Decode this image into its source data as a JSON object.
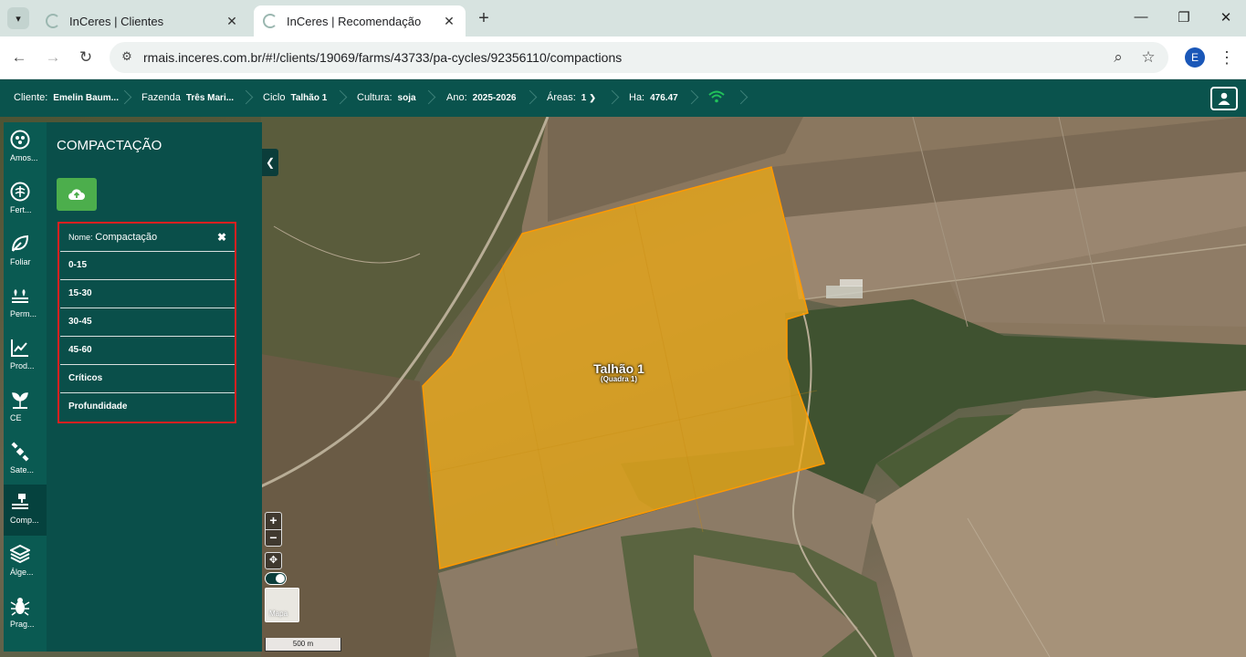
{
  "browser": {
    "tabs": [
      {
        "title": "InCeres | Clientes",
        "active": false
      },
      {
        "title": "InCeres | Recomendação",
        "active": true
      }
    ],
    "url": "rmais.inceres.com.br/#!/clients/19069/farms/43733/pa-cycles/92356110/compactions",
    "profile_initial": "E"
  },
  "header": {
    "crumbs": [
      {
        "key": "Cliente:",
        "value": "Emelin Baum..."
      },
      {
        "key": "Fazenda",
        "value": "Três Mari..."
      },
      {
        "key": "Ciclo",
        "value": "Talhão 1"
      },
      {
        "key": "Cultura:",
        "value": "soja"
      },
      {
        "key": "Ano:",
        "value": "2025-2026"
      },
      {
        "key": "Áreas:",
        "value": "1"
      },
      {
        "key": "Ha:",
        "value": "476.47"
      }
    ],
    "accent": "#21c15a"
  },
  "sidebar": {
    "items": [
      {
        "label": "Amos...",
        "icon": "sampling-icon"
      },
      {
        "label": "Fert...",
        "icon": "fertility-icon"
      },
      {
        "label": "Foliar",
        "icon": "leaf-icon"
      },
      {
        "label": "Perm...",
        "icon": "permanent-crop-icon"
      },
      {
        "label": "Prod...",
        "icon": "productivity-chart-icon"
      },
      {
        "label": "CE",
        "icon": "ce-plant-icon"
      },
      {
        "label": "Sate...",
        "icon": "satellite-icon"
      },
      {
        "label": "Comp...",
        "icon": "compaction-icon",
        "active": true
      },
      {
        "label": "Álge...",
        "icon": "layers-icon"
      },
      {
        "label": "Prag...",
        "icon": "pest-bug-icon"
      }
    ]
  },
  "panel": {
    "title": "COMPACTAÇÃO",
    "name_key": "Nome:",
    "name_value": "Compactação",
    "items": [
      "0-15",
      "15-30",
      "30-45",
      "45-60",
      "Críticos",
      "Profundidade"
    ]
  },
  "map": {
    "field_name": "Talhão 1",
    "field_sub": "(Quadra 1)",
    "zoom_in": "+",
    "zoom_out": "−",
    "map_type_label": "Mapa",
    "scale_label": "500 m",
    "field_color": "#f2ad1c"
  }
}
